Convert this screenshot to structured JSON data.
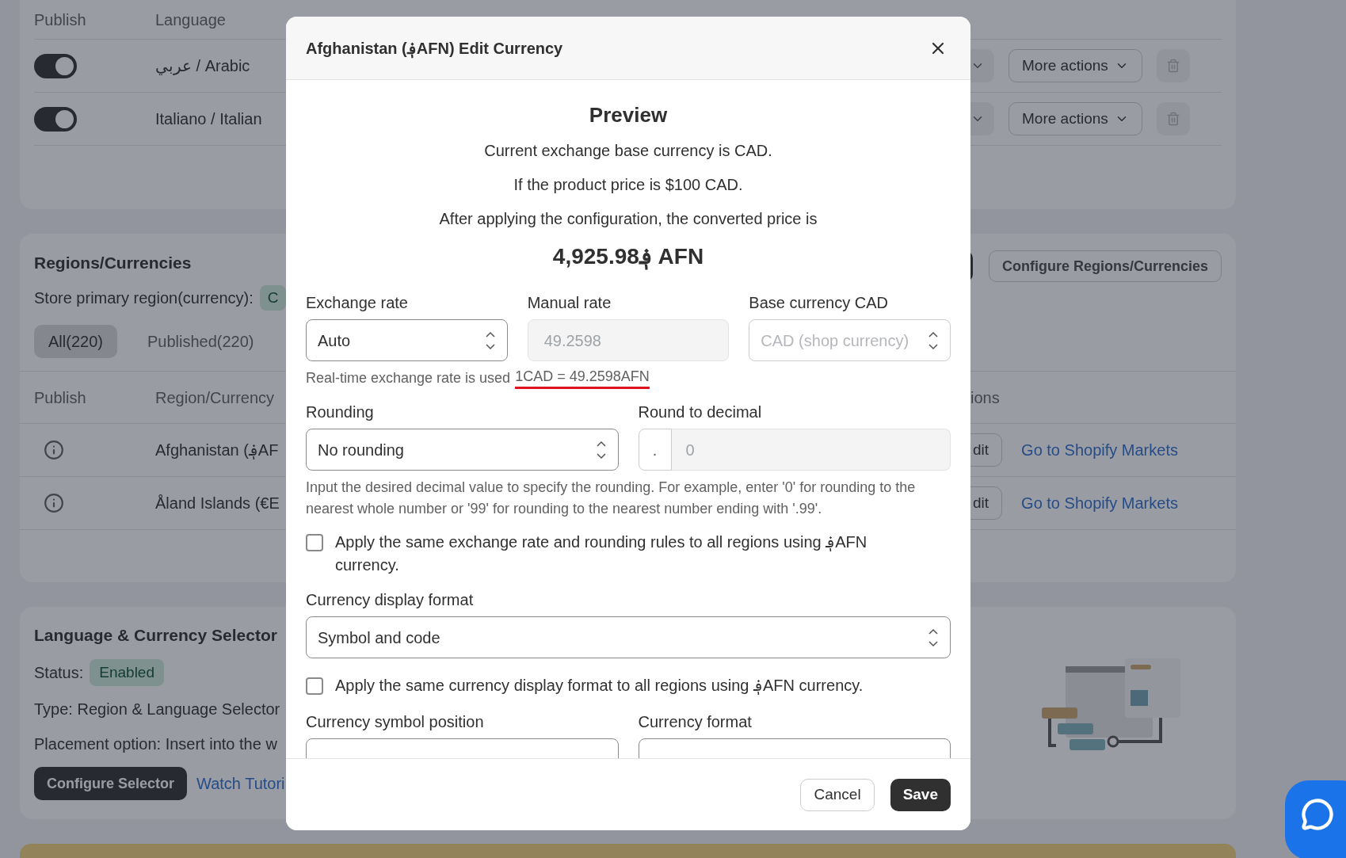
{
  "languages_card": {
    "columns": [
      "Publish",
      "Language"
    ],
    "rows": [
      {
        "on": true,
        "language": "عربي / Arabic",
        "more_actions": "More actions"
      },
      {
        "on": true,
        "language": "Italiano / Italian",
        "more_actions": "More actions"
      }
    ]
  },
  "regions_card": {
    "title": "Regions/Currencies",
    "primary_label": "Store primary region(currency):",
    "primary_badge": "C",
    "configure_button": "Configure Regions/Currencies",
    "filters": [
      {
        "label": "All(220)",
        "selected": true
      },
      {
        "label": "Published(220)",
        "selected": false
      }
    ],
    "columns": [
      "Publish",
      "Region/Currency",
      "ions"
    ],
    "rows": [
      {
        "region": "Afghanistan (؋AF",
        "edit": "dit",
        "link": "Go to Shopify Markets"
      },
      {
        "region": "Åland Islands (€E",
        "edit": "dit",
        "link": "Go to Shopify Markets"
      }
    ]
  },
  "selector_card": {
    "title": "Language & Currency Selector",
    "status_label": "Status:",
    "status": "Enabled",
    "type": "Type: Region & Language Selector",
    "placement": "Placement option: Insert into the w",
    "configure_button": "Configure Selector",
    "tutorial_link": "Watch Tutori"
  },
  "dialog": {
    "title": "Afghanistan (؋AFN) Edit Currency",
    "preview_title": "Preview",
    "preview_lines": [
      "Current exchange base currency is CAD.",
      "If the product price is $100 CAD.",
      "After applying the configuration, the converted price is"
    ],
    "converted_price": "4,925.98؋ AFN",
    "exchange_rate": {
      "label": "Exchange rate",
      "value": "Auto",
      "disabled": false
    },
    "manual_rate": {
      "label": "Manual rate",
      "value": "49.2598",
      "disabled": true
    },
    "base_currency": {
      "label": "Base currency CAD",
      "value": "CAD (shop currency)",
      "disabled": true
    },
    "rate_note": "Real-time exchange rate is used",
    "rate_value": "1CAD = 49.2598AFN",
    "rate_highlighted": true,
    "rounding": {
      "label": "Rounding",
      "value": "No rounding",
      "disabled": false
    },
    "round_to_decimal": {
      "label": "Round to decimal",
      "prefix": ".",
      "placeholder": "0"
    },
    "rounding_help": "Input the desired decimal value to specify the rounding. For example, enter '0' for rounding to the nearest whole number or '99' for rounding to the nearest number ending with '.99'.",
    "apply_rate_all": {
      "label": "Apply the same exchange rate and rounding rules to all regions using ؋AFN currency.",
      "checked": false
    },
    "display_format": {
      "label": "Currency display format",
      "value": "Symbol and code",
      "disabled": false
    },
    "apply_format_all": {
      "label": "Apply the same currency display format to all regions using ؋AFN currency.",
      "checked": false
    },
    "symbol_position": {
      "label": "Currency symbol position"
    },
    "currency_format": {
      "label": "Currency format"
    },
    "buttons": [
      {
        "label": "Cancel",
        "kind": "secondary"
      },
      {
        "label": "Save",
        "kind": "primary"
      }
    ]
  }
}
